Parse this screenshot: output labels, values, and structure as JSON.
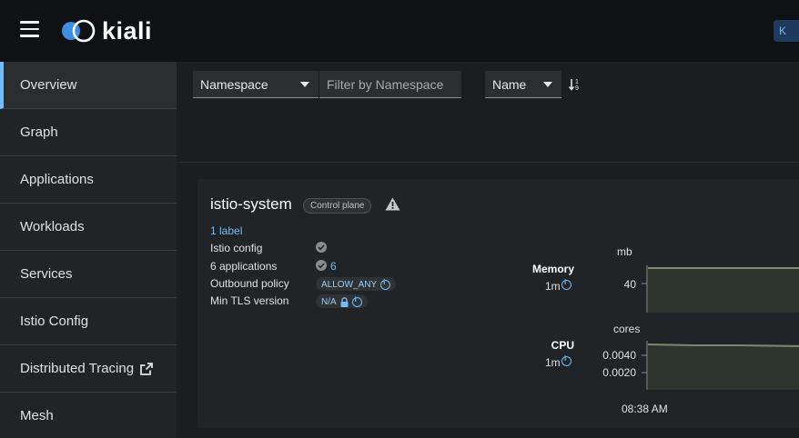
{
  "header": {
    "app_name": "kiali",
    "chip_label": "K"
  },
  "sidebar": {
    "items": [
      {
        "label": "Overview",
        "active": true
      },
      {
        "label": "Graph"
      },
      {
        "label": "Applications"
      },
      {
        "label": "Workloads"
      },
      {
        "label": "Services"
      },
      {
        "label": "Istio Config"
      },
      {
        "label": "Distributed Tracing",
        "external_icon": "external-link-icon"
      },
      {
        "label": "Mesh"
      }
    ]
  },
  "toolbar": {
    "filter_type": "Namespace",
    "filter_placeholder": "Filter by Namespace",
    "sort_field": "Name",
    "sort_icon": "sort-ascending-icon"
  },
  "namespace_card": {
    "name": "istio-system",
    "badge": "Control plane",
    "warning_icon": "warning-triangle-icon",
    "labels_link": "1 label",
    "istio_config_label": "Istio config",
    "applications_label": "6 applications",
    "applications_count": "6",
    "outbound_policy_label": "Outbound policy",
    "outbound_policy_value": "ALLOW_ANY",
    "min_tls_label": "Min TLS version",
    "min_tls_value": "N/A",
    "status_color": "#8a8d90",
    "link_color": "#73bcf7"
  },
  "metrics": {
    "memory": {
      "title": "Memory",
      "interval": "1m",
      "unit": "mb",
      "ticks": [
        "40"
      ]
    },
    "cpu": {
      "title": "CPU",
      "interval": "1m",
      "unit": "cores",
      "ticks": [
        "0.0040",
        "0.0020"
      ]
    },
    "time_label": "08:38 AM",
    "area_color": "#2d342d",
    "line_color": "#7a8a6e"
  }
}
